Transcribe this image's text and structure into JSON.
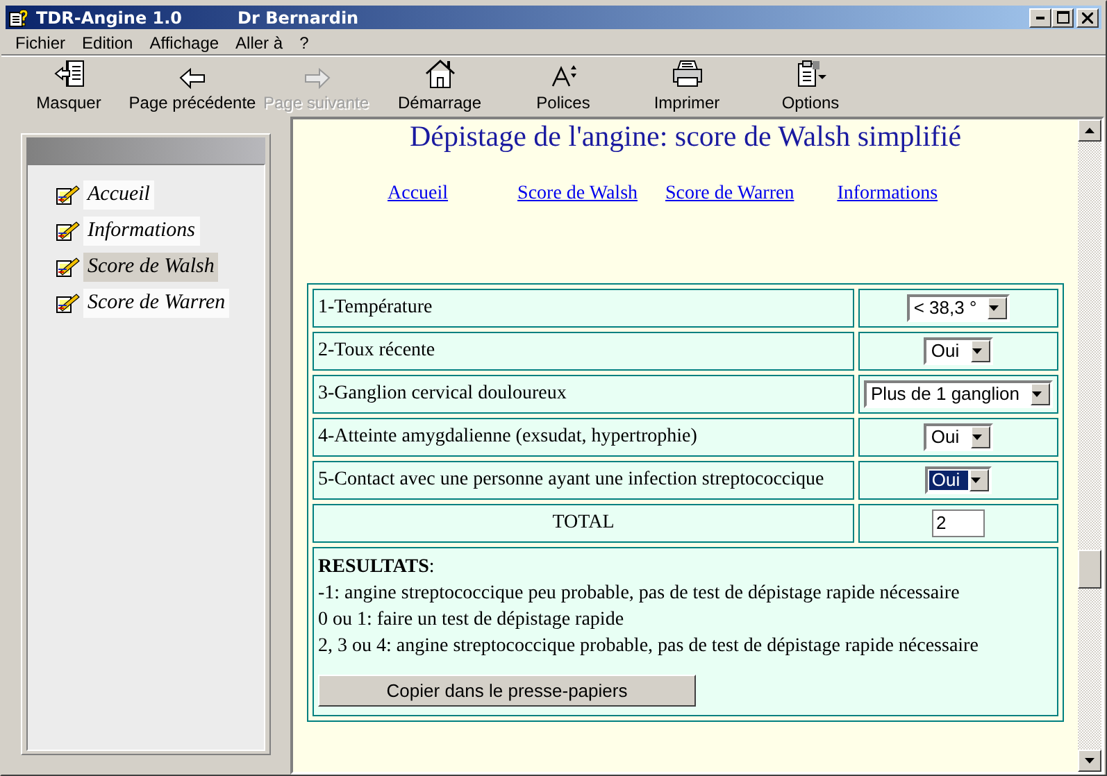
{
  "window": {
    "title": "TDR-Angine 1.0",
    "user": "Dr Bernardin"
  },
  "menu": [
    {
      "label": "Fichier"
    },
    {
      "label": "Edition"
    },
    {
      "label": "Affichage"
    },
    {
      "label": "Aller à"
    },
    {
      "label": "?"
    }
  ],
  "toolbar": [
    {
      "label": "Masquer",
      "kind": "hide",
      "disabled": false
    },
    {
      "label": "Page précédente",
      "kind": "back",
      "disabled": false
    },
    {
      "label": "Page suivante",
      "kind": "forward",
      "disabled": true
    },
    {
      "label": "Démarrage",
      "kind": "home",
      "disabled": false
    },
    {
      "label": "Polices",
      "kind": "fonts",
      "disabled": false
    },
    {
      "label": "Imprimer",
      "kind": "print",
      "disabled": false
    },
    {
      "label": "Options",
      "kind": "options",
      "disabled": false
    }
  ],
  "sidebar": {
    "items": [
      {
        "label": "Accueil",
        "selected": false
      },
      {
        "label": "Informations",
        "selected": false
      },
      {
        "label": "Score de Walsh",
        "selected": true
      },
      {
        "label": "Score de Warren",
        "selected": false
      }
    ]
  },
  "page": {
    "heading": "Dépistage de l'angine: score de Walsh simplifié",
    "links": [
      "Accueil",
      "Score de Walsh",
      "Score de Warren",
      "Informations"
    ],
    "criteria": [
      {
        "label": "1-Température",
        "value": "< 38,3 °",
        "focused": false
      },
      {
        "label": "2-Toux récente",
        "value": "Oui",
        "focused": false
      },
      {
        "label": "3-Ganglion cervical douloureux",
        "value": "Plus de 1 ganglion",
        "focused": false
      },
      {
        "label": "4-Atteinte amygdalienne (exsudat, hypertrophie)",
        "value": "Oui",
        "focused": false
      },
      {
        "label": "5-Contact avec une personne ayant une infection streptococcique",
        "value": "Oui",
        "focused": true
      }
    ],
    "total": {
      "label": "TOTAL",
      "value": "2"
    },
    "results": {
      "heading": "**RESULTATS**:",
      "lines": [
        "-1: angine streptococcique peu probable, pas de test de dépistage rapide nécessaire",
        "0 ou 1: faire un test de dépistage rapide",
        "2, 3 ou 4: angine streptococcique probable, pas de test de dépistage rapide nécessaire"
      ],
      "button": "Copier dans le presse-papiers"
    }
  }
}
